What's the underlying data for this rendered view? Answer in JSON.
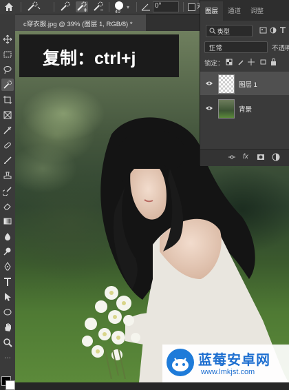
{
  "options_bar": {
    "size_value": "40",
    "angle_value": "0°",
    "checkbox_label": "对"
  },
  "document_tab": {
    "title": "c穿衣服.jpg @ 39% (图层 1, RGB/8) *"
  },
  "overlay_caption": "复制：ctrl+j",
  "layers_panel": {
    "tabs": [
      "图层",
      "通道",
      "调整"
    ],
    "filter_label": "类型",
    "blend_mode": "正常",
    "opacity_label": "不透明",
    "lock_label": "锁定：",
    "layers": [
      {
        "name": "图层 1",
        "selected": true,
        "thumbnail": "transparent"
      },
      {
        "name": "背景",
        "selected": false,
        "thumbnail": "image"
      }
    ],
    "footer_icons": [
      "link-icon",
      "fx-icon",
      "mask-icon",
      "adjustment-icon"
    ],
    "footer_fx": "fx"
  },
  "watermark": {
    "brand": "蓝莓安卓网",
    "url": "www.lmkjst.com"
  },
  "colors": {
    "foreground": "#000000",
    "background": "#ffffff",
    "selected_layer": "#505050",
    "brand_blue": "#1e6fd0"
  }
}
